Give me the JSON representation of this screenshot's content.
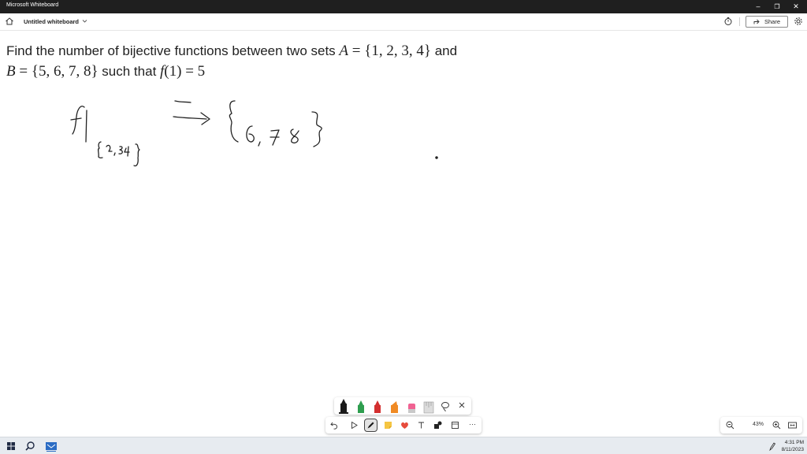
{
  "window": {
    "app_title": "Microsoft Whiteboard",
    "minimize_glyph": "–",
    "restore_glyph": "❐",
    "close_glyph": "✕"
  },
  "appbar": {
    "board_title": "Untitled whiteboard",
    "share_label": "Share",
    "icons": [
      "home-icon",
      "chevron-down-icon",
      "timer-icon",
      "share-icon",
      "gear-icon"
    ]
  },
  "canvas": {
    "question": {
      "line1_text": "Find the number of bijective functions between two sets",
      "line1_var": "A",
      "line1_set": " = {1, 2, 3, 4}",
      "line1_tail": " and",
      "line2_var": "B",
      "line2_set": " = {5, 6, 7, 8}",
      "line2_mid": " such that ",
      "line2_fvar": "f",
      "line2_end": "(1) = 5"
    },
    "ink_notes": {
      "restriction_label": "f",
      "restriction_subscript": "{2,3,4}",
      "arrow": "⟹",
      "target_set": "{6,7,8}"
    }
  },
  "pen_tray": {
    "tools": [
      "black-pen",
      "green-pen",
      "red-pen",
      "orange-highlighter",
      "pink-highlighter",
      "ruler",
      "lasso"
    ],
    "colors": {
      "black": "#1a1a1a",
      "green": "#2e9e4f",
      "red": "#d32f2f",
      "orange": "#f08a24",
      "pink": "#f06292"
    }
  },
  "main_tools": {
    "tools": [
      "undo-icon",
      "select-icon",
      "pen-icon",
      "sticky-note-icon",
      "reaction-icon",
      "text-icon",
      "shapes-icon",
      "templates-icon",
      "more-icon"
    ],
    "more_glyph": "···"
  },
  "zoom": {
    "value": "43%"
  },
  "taskbar": {
    "time": "4:31 PM",
    "date": "8/11/2023"
  }
}
